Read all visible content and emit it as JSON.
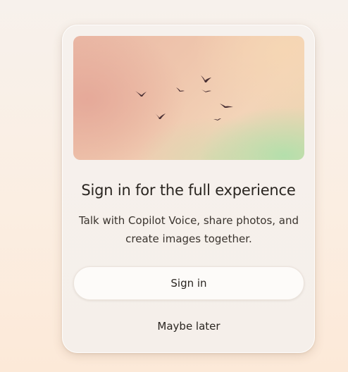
{
  "dialog": {
    "title": "Sign in for the full experience",
    "description": "Talk with Copilot Voice, share photos, and create images together.",
    "sign_in_label": "Sign in",
    "maybe_later_label": "Maybe later"
  },
  "hero": {
    "image_subject": "birds-in-sky-illustration"
  },
  "colors": {
    "text": "#2a2520",
    "card_background": "#f6f1ed",
    "button_background": "#fdfbf9"
  }
}
